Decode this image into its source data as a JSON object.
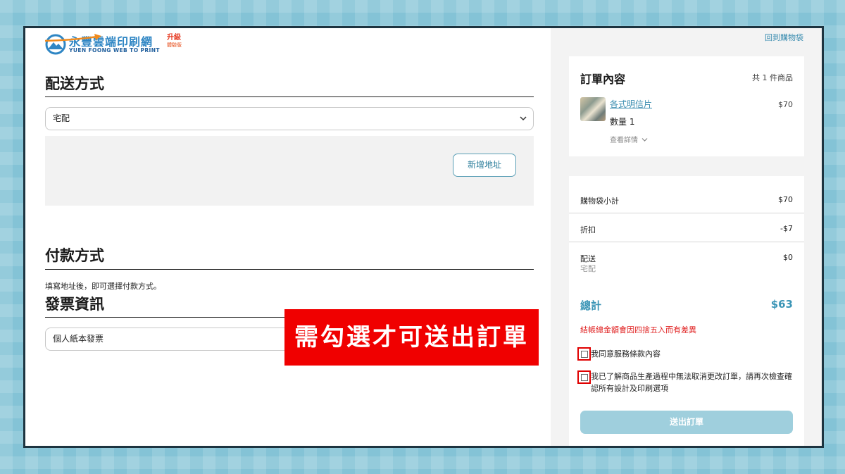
{
  "brand": {
    "name_cn": "永豐雲端印刷網",
    "name_en": "YUEN FOONG WEB TO PRINT",
    "upgrade_badge": "升級",
    "edition_badge": "體驗版"
  },
  "delivery": {
    "title": "配送方式",
    "selected": "宅配",
    "add_address_label": "新增地址"
  },
  "payment": {
    "title": "付款方式",
    "note": "填寫地址後，即可選擇付款方式。"
  },
  "invoice": {
    "title": "發票資訊",
    "selected": "個人紙本發票"
  },
  "callout": "需勾選才可送出訂單",
  "sidebar": {
    "back_link": "回到購物袋",
    "order": {
      "title": "訂單內容",
      "count": "共 1 件商品",
      "item": {
        "name": "各式明信片",
        "price": "$70",
        "qty": "數量 1",
        "details": "查看詳情"
      }
    },
    "summary": {
      "subtotal_label": "購物袋小計",
      "subtotal": "$70",
      "discount_label": "折扣",
      "discount": "-$7",
      "shipping_label": "配送",
      "shipping": "$0",
      "shipping_method": "宅配",
      "total_label": "總計",
      "total": "$63",
      "rounding_note": "結帳總金額會因四捨五入而有差異"
    },
    "agreements": {
      "terms": "我同意服務條款內容",
      "no_cancel": "我已了解商品生產過程中無法取消更改訂單，請再次檢查確認所有設計及印刷選項"
    },
    "submit_label": "送出訂單"
  },
  "colors": {
    "accent": "#3b95b6",
    "warning": "#e02020",
    "callout": "#f00000",
    "submit_disabled": "#9fcfdd"
  }
}
